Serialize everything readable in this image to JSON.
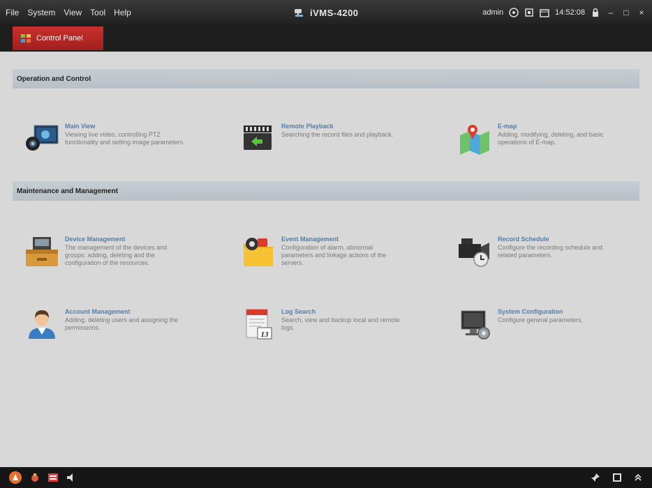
{
  "titlebar": {
    "menu": [
      "File",
      "System",
      "View",
      "Tool",
      "Help"
    ],
    "app_title": "iVMS-4200",
    "user": "admin",
    "time": "14:52:08",
    "minimize": "–",
    "maximize": "□",
    "close": "×"
  },
  "tab": {
    "label": "Control Panel"
  },
  "sections": [
    {
      "title": "Operation and Control",
      "items": [
        {
          "title": "Main View",
          "desc": "Viewing live video, controlling PTZ functionality and setting image parameters.",
          "icon": "main-view-icon"
        },
        {
          "title": "Remote Playback",
          "desc": "Searching the record files and playback.",
          "icon": "remote-playback-icon"
        },
        {
          "title": "E-map",
          "desc": "Adding, modifying, deleting, and basic operations of E-map.",
          "icon": "e-map-icon"
        }
      ]
    },
    {
      "title": "Maintenance and Management",
      "items": [
        {
          "title": "Device Management",
          "desc": "The management of the devices and groups: adding, deleting and the configuration of the resources.",
          "icon": "device-management-icon"
        },
        {
          "title": "Event Management",
          "desc": "Configuration of alarm, abnormal parameters and linkage actions of the servers.",
          "icon": "event-management-icon"
        },
        {
          "title": "Record Schedule",
          "desc": "Configure the recording schedule and related parameters.",
          "icon": "record-schedule-icon"
        },
        {
          "title": "Account Management",
          "desc": "Adding, deleting users and assigning the permissions.",
          "icon": "account-management-icon"
        },
        {
          "title": "Log Search",
          "desc": "Search, view and backup local and remote logs.",
          "icon": "log-search-icon"
        },
        {
          "title": "System Configuration",
          "desc": "Configure general parameters.",
          "icon": "system-configuration-icon"
        }
      ]
    }
  ],
  "log_icon_day": "13",
  "colors": {
    "accent_tab": "#b52a26",
    "titlebar": "#2a2a2a",
    "section_header": "#bcc4ca",
    "item_title": "#4d7fb0"
  }
}
